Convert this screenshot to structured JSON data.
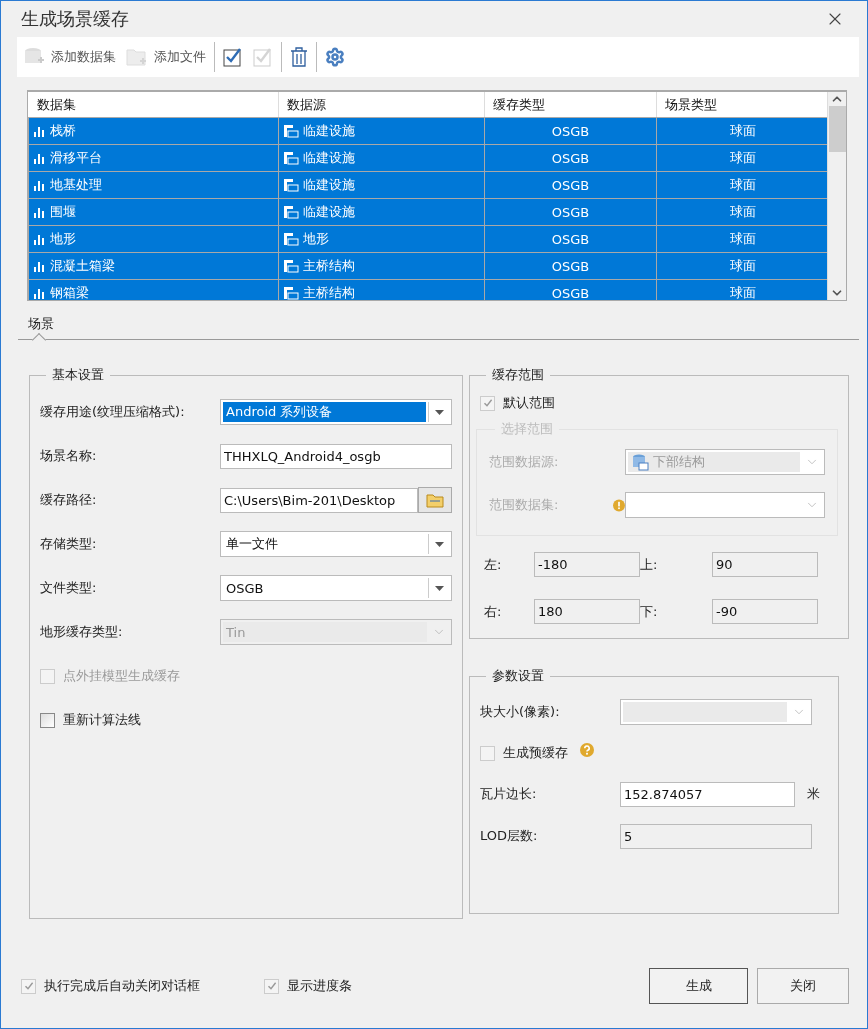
{
  "window": {
    "title": "生成场景缓存"
  },
  "toolbar": [
    {
      "kind": "add-dataset",
      "label": "添加数据集",
      "disabled": true
    },
    {
      "kind": "add-file",
      "label": "添加文件",
      "disabled": true
    },
    {
      "kind": "check-all",
      "disabled": false
    },
    {
      "kind": "check-none",
      "disabled": true
    },
    {
      "kind": "delete",
      "disabled": false
    },
    {
      "kind": "settings",
      "disabled": false
    }
  ],
  "table": {
    "columns": [
      "数据集",
      "数据源",
      "缓存类型",
      "场景类型"
    ],
    "rows": [
      {
        "dataset": "栈桥",
        "source": "临建设施",
        "cache_type": "OSGB",
        "scene_type": "球面",
        "selected": true
      },
      {
        "dataset": "滑移平台",
        "source": "临建设施",
        "cache_type": "OSGB",
        "scene_type": "球面",
        "selected": true
      },
      {
        "dataset": "地基处理",
        "source": "临建设施",
        "cache_type": "OSGB",
        "scene_type": "球面",
        "selected": true
      },
      {
        "dataset": "围堰",
        "source": "临建设施",
        "cache_type": "OSGB",
        "scene_type": "球面",
        "selected": true
      },
      {
        "dataset": "地形",
        "source": "地形",
        "cache_type": "OSGB",
        "scene_type": "球面",
        "selected": true
      },
      {
        "dataset": "混凝土箱梁",
        "source": "主桥结构",
        "cache_type": "OSGB",
        "scene_type": "球面",
        "selected": true
      },
      {
        "dataset": "钢箱梁",
        "source": "主桥结构",
        "cache_type": "OSGB",
        "scene_type": "球面",
        "selected": true
      }
    ]
  },
  "tabs": [
    {
      "label": "场景",
      "selected": true
    }
  ],
  "basic": {
    "title": "基本设置",
    "fields": [
      {
        "kind": "select",
        "label": "缓存用途(纹理压缩格式):",
        "value": "Android 系列设备",
        "focused": true,
        "disabled": false
      },
      {
        "kind": "text",
        "label": "场景名称:",
        "value": "THHXLQ_Android4_osgb",
        "focused": false,
        "disabled": false
      },
      {
        "kind": "path",
        "label": "缓存路径:",
        "value": "C:\\Users\\Bim-201\\Desktop",
        "focused": false,
        "disabled": false
      },
      {
        "kind": "select",
        "label": "存储类型:",
        "value": "单一文件",
        "focused": false,
        "disabled": false
      },
      {
        "kind": "select",
        "label": "文件类型:",
        "value": "OSGB",
        "focused": false,
        "disabled": false
      },
      {
        "kind": "select",
        "label": "地形缓存类型:",
        "value": "Tin",
        "focused": false,
        "disabled": true
      }
    ],
    "checks": [
      {
        "label": "点外挂模型生成缓存",
        "checked": false,
        "disabled": true
      },
      {
        "label": "重新计算法线",
        "checked": false,
        "disabled": false
      }
    ]
  },
  "range": {
    "title": "缓存范围",
    "default_range": {
      "label": "默认范围",
      "checked": true,
      "disabled": true
    },
    "selection": {
      "title": "选择范围",
      "disabled": true,
      "source": {
        "label": "范围数据源:",
        "value": "下部结构"
      },
      "dataset": {
        "label": "范围数据集:",
        "warning": true
      }
    },
    "bounds": [
      {
        "label": "左:",
        "value": "-180"
      },
      {
        "label": "上:",
        "value": "90"
      },
      {
        "label": "右:",
        "value": "180"
      },
      {
        "label": "下:",
        "value": "-90"
      }
    ]
  },
  "params": {
    "title": "参数设置",
    "block_size": {
      "label": "块大小(像素):",
      "disabled": true
    },
    "precache": {
      "label": "生成预缓存",
      "checked": false,
      "help": true
    },
    "tile": {
      "label": "瓦片边长:",
      "value": "152.874057",
      "unit": "米"
    },
    "lod": {
      "label": "LOD层数:",
      "value": "5",
      "disabled": true
    }
  },
  "footer": {
    "checks": [
      {
        "label": "执行完成后自动关闭对话框",
        "checked": true,
        "disabled": true
      },
      {
        "label": "显示进度条",
        "checked": true,
        "disabled": true
      }
    ],
    "buttons": [
      {
        "label": "生成",
        "default": true
      },
      {
        "label": "关闭",
        "default": false
      }
    ]
  }
}
